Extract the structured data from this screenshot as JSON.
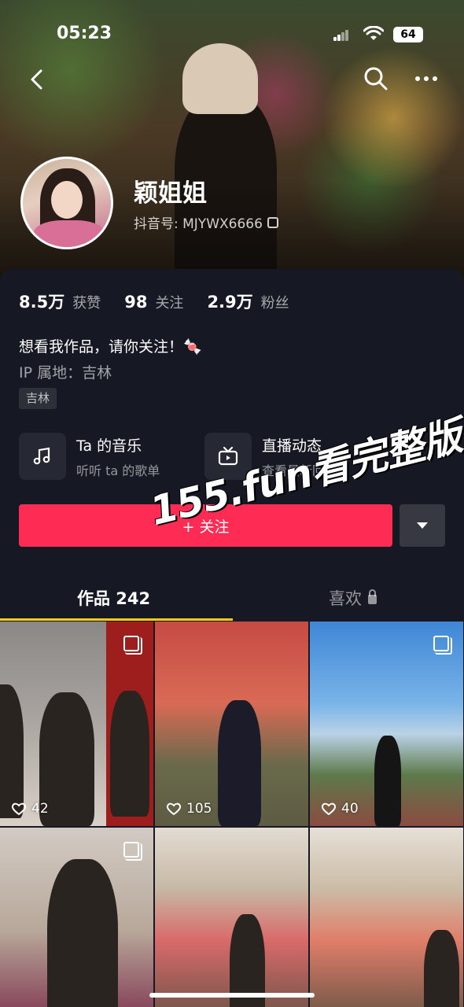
{
  "status_bar": {
    "time": "05:23",
    "battery": "64"
  },
  "profile": {
    "name": "颖姐姐",
    "douyin_id": "抖音号: MJYWX6666",
    "bio": "想看我作品，请你关注！🍬",
    "ip": "IP 属地：吉林",
    "tag": "吉林"
  },
  "stats": [
    {
      "num": "8.5万",
      "label": "获赞"
    },
    {
      "num": "98",
      "label": "关注"
    },
    {
      "num": "2.9万",
      "label": "粉丝"
    }
  ],
  "features": [
    {
      "title": "Ta 的音乐",
      "sub": "听听 ta 的歌单",
      "icon": "music-note-icon"
    },
    {
      "title": "直播动态",
      "sub": "查看最新回放",
      "icon": "tv-icon"
    }
  ],
  "follow_button": "+ 关注",
  "watermark": "155.fun看完整版",
  "tabs": {
    "works": "作品 242",
    "likes": "喜欢"
  },
  "videos": [
    {
      "likes": "42",
      "multi": true
    },
    {
      "likes": "105",
      "multi": false
    },
    {
      "likes": "40",
      "multi": true
    },
    {
      "likes": "",
      "multi": true
    },
    {
      "likes": "",
      "multi": false
    },
    {
      "likes": "",
      "multi": false
    }
  ],
  "colors": {
    "accent": "#fe2c55",
    "tab_underline": "#facc15",
    "background": "#161823"
  }
}
